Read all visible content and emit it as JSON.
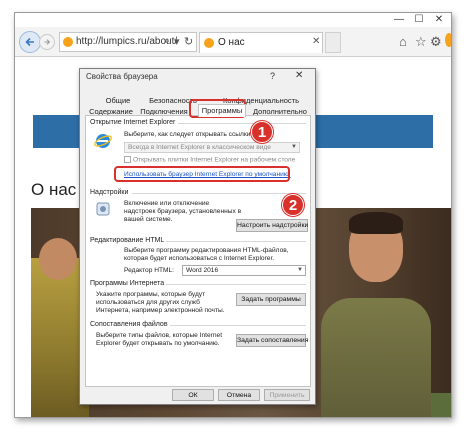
{
  "browser": {
    "address": "http://lumpics.ru/about/",
    "tab_title": "О нас",
    "window_controls": [
      "—",
      "☐",
      "✕"
    ]
  },
  "page": {
    "title": "О нас"
  },
  "dialog": {
    "title": "Свойства браузера",
    "help": "?",
    "close": "✕",
    "tabs_row1": [
      "Общие",
      "Безопасность",
      "Конфиденциальность"
    ],
    "tabs_row2": [
      "Содержание",
      "Подключения",
      "Программы",
      "Дополнительно"
    ],
    "active_tab": "Программы",
    "open_group": {
      "label": "Открытие Internet Explorer",
      "text": "Выберите, как следует открывать ссылки.",
      "select_value": "Всегда в Internet Explorer в классическом виде",
      "checkbox_label": "Открывать плитки Internet Explorer на рабочем столе",
      "default_link": "Использовать браузер Internet Explorer по умолчанию."
    },
    "addons_group": {
      "label": "Надстройки",
      "text": "Включение или отключение надстроек браузера, установленных в вашей системе.",
      "button": "Настроить надстройки"
    },
    "html_group": {
      "label": "Редактирование HTML",
      "text": "Выберите программу редактирования HTML-файлов, которая будет использоваться с Internet Explorer.",
      "editor_label": "Редактор HTML:",
      "editor_value": "Word 2016"
    },
    "programs_group": {
      "label": "Программы Интернета",
      "text": "Укажите программы, которые будут использоваться для других служб Интернета, например электронной почты.",
      "button": "Задать программы"
    },
    "assoc_group": {
      "label": "Сопоставления файлов",
      "text": "Выберите типы файлов, которые Internet Explorer будет открывать по умолчанию.",
      "button": "Задать сопоставления"
    },
    "footer": {
      "ok": "ОК",
      "cancel": "Отмена",
      "apply": "Применить"
    }
  },
  "annotations": {
    "marker1": "1",
    "marker2": "2",
    "highlight_color": "#d8302a"
  },
  "colors": {
    "banner": "#2e6ea6",
    "favicon": "#f7a21b",
    "link": "#1a55c8"
  }
}
